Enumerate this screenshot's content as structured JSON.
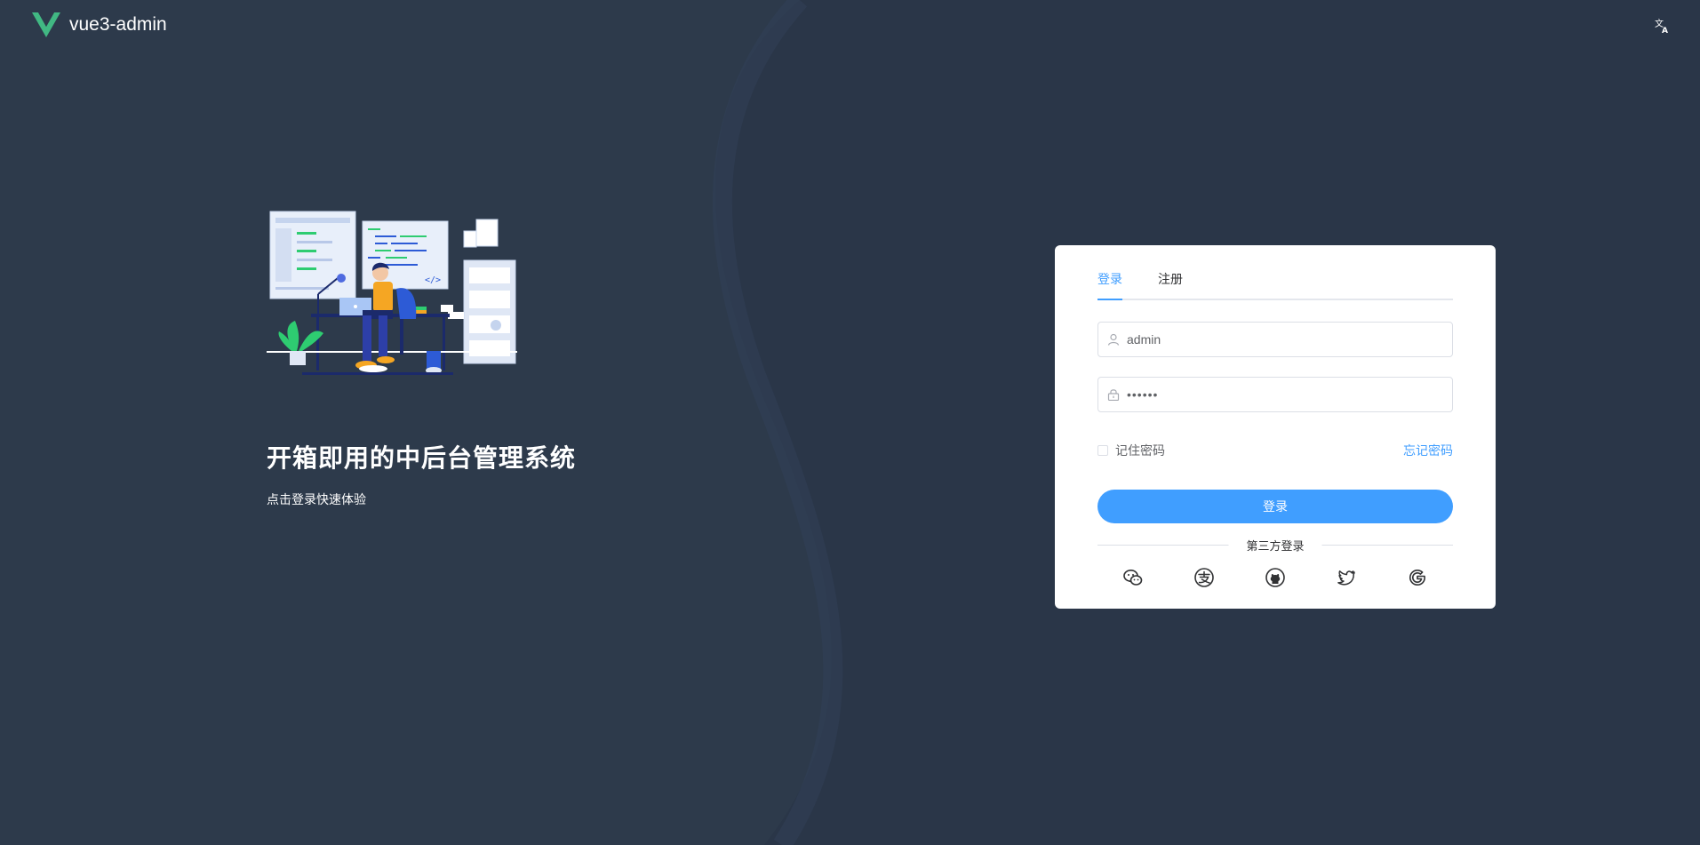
{
  "app": {
    "name": "vue3-admin",
    "logo_icon": "vue-logo-icon",
    "language_icon": "translate-icon"
  },
  "hero": {
    "title": "开箱即用的中后台管理系统",
    "subtitle": "点击登录快速体验"
  },
  "login": {
    "tabs": [
      {
        "label": "登录",
        "active": true
      },
      {
        "label": "注册",
        "active": false
      }
    ],
    "username": {
      "value": "admin",
      "icon": "user-icon"
    },
    "password": {
      "value": "••••••",
      "icon": "lock-icon"
    },
    "remember_label": "记住密码",
    "remember_checked": false,
    "forgot_label": "忘记密码",
    "submit_label": "登录",
    "third_party_label": "第三方登录",
    "social_icons": [
      "wechat-icon",
      "alipay-icon",
      "github-icon",
      "twitter-icon",
      "google-icon"
    ]
  },
  "colors": {
    "background": "#2d3a4b",
    "accent": "#409eff",
    "brand_green": "#41b883"
  }
}
